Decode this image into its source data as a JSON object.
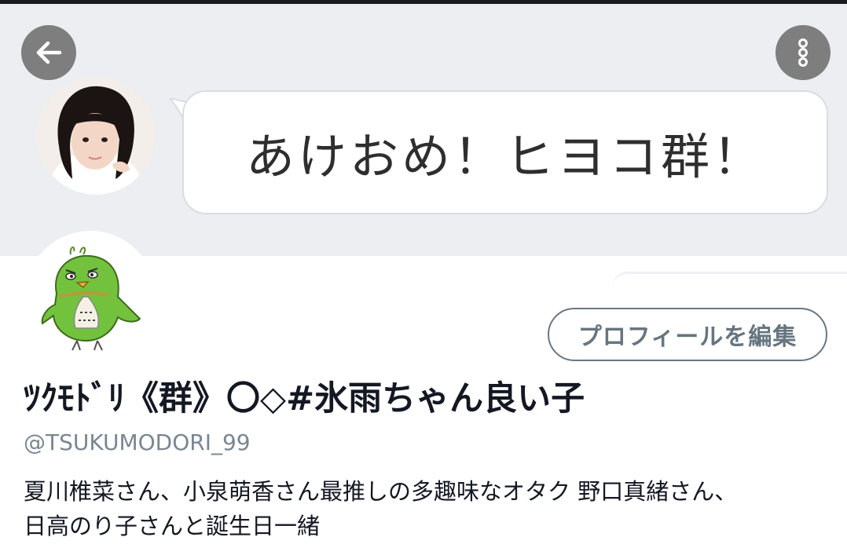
{
  "header": {
    "banner_text": "あけおめ！ヒヨコ群！",
    "back_icon": "arrow-left-icon",
    "more_icon": "more-vertical-icon"
  },
  "profile": {
    "edit_button_label": "プロフィールを編集",
    "display_name": "ﾂｸﾓﾄﾞﾘ《群》〇◇#氷雨ちゃん良い子",
    "handle": "@TSUKUMODORI_99",
    "bio_lines": [
      "夏川椎菜さん、小泉萌香さん最推しの多趣味なオタク 野口真緒さん、",
      "日高のり子さんと誕生日一緒"
    ]
  },
  "colors": {
    "banner_bg": "#eceef2",
    "edit_button_border": "#6a7684",
    "handle_text": "#7a8691",
    "round_button": "#6e6e6e"
  }
}
